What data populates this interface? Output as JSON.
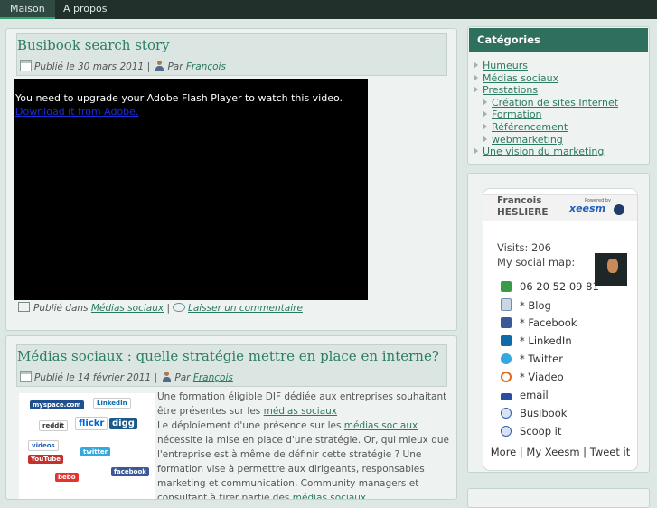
{
  "nav": {
    "home": "Maison",
    "about": "A propos"
  },
  "posts": [
    {
      "title": "Busibook search story",
      "published": "Publié le 30 mars 2011",
      "sep": "|",
      "by": "Par",
      "author": "François",
      "video_msg": "You need to upgrade your Adobe Flash Player to watch this video.",
      "video_link": "Download it from Adobe.",
      "filed_in": "Publié dans",
      "category": "Médias sociaux",
      "comment": "Laisser un commentaire"
    },
    {
      "title": "Médias sociaux : quelle stratégie mettre en place en interne?",
      "published": "Publié le 14 février 2011",
      "sep": "|",
      "by": "Par",
      "author": "François",
      "excerpt_1": "Une formation éligible DIF dédiée aux entreprises souhaitant être présentes sur les",
      "excerpt_link_1": "médias sociaux",
      "excerpt_2": "Le déploiement d'une présence sur les",
      "excerpt_link_2": "médias sociaux",
      "excerpt_3": "nécessite la mise en place d'une stratégie. Or, qui mieux que l'entreprise est à même de définir cette stratégie ? Une formation vise à permettre aux dirigeants, responsables marketing et communication, Community managers et consultant à tirer partie des",
      "excerpt_link_3": "médias sociaux",
      "thumb_logos": [
        "myspace.com",
        "LinkedIn",
        "reddit",
        "flickr",
        "digg",
        "videos",
        "YouTube",
        "bebo",
        "facebook",
        "twitter"
      ]
    }
  ],
  "sidebar": {
    "categories_title": "Catégories",
    "categories": [
      "Humeurs",
      "Médias sociaux",
      "Prestations",
      "Création de sites Internet",
      "Formation",
      "Référencement",
      "webmarketing",
      "Une vision du marketing"
    ],
    "card": {
      "first_name": "Francois",
      "last_name": "HESLIERE",
      "powered": "Powered by",
      "brand": "xeesm",
      "visits": "Visits: 206",
      "social_map": "My social map:",
      "items": [
        {
          "icon": "phone-icon",
          "label": "06 20 52 09 81",
          "color": "#3a9a4a"
        },
        {
          "icon": "document-icon",
          "label": "* Blog",
          "color": "#6d8fb0"
        },
        {
          "icon": "facebook-icon",
          "label": "* Facebook",
          "color": "#3b5998"
        },
        {
          "icon": "linkedin-icon",
          "label": "* LinkedIn",
          "color": "#0e6aa8"
        },
        {
          "icon": "twitter-icon",
          "label": "* Twitter",
          "color": "#33a9e0"
        },
        {
          "icon": "viadeo-icon",
          "label": "* Viadeo",
          "color": "#e06a1b"
        },
        {
          "icon": "email-icon",
          "label": "email",
          "color": "#2a4fa0"
        },
        {
          "icon": "busibook-icon",
          "label": "Busibook",
          "color": "#2f5fa8"
        },
        {
          "icon": "scoop-icon",
          "label": "Scoop it",
          "color": "#2f5fa8"
        }
      ],
      "more": "More | My Xeesm | Tweet it"
    }
  },
  "colors": {
    "topbar": "#22302c",
    "accent": "#2e6f5e",
    "title": "#2d7d62",
    "link": "#2a7a5e"
  }
}
